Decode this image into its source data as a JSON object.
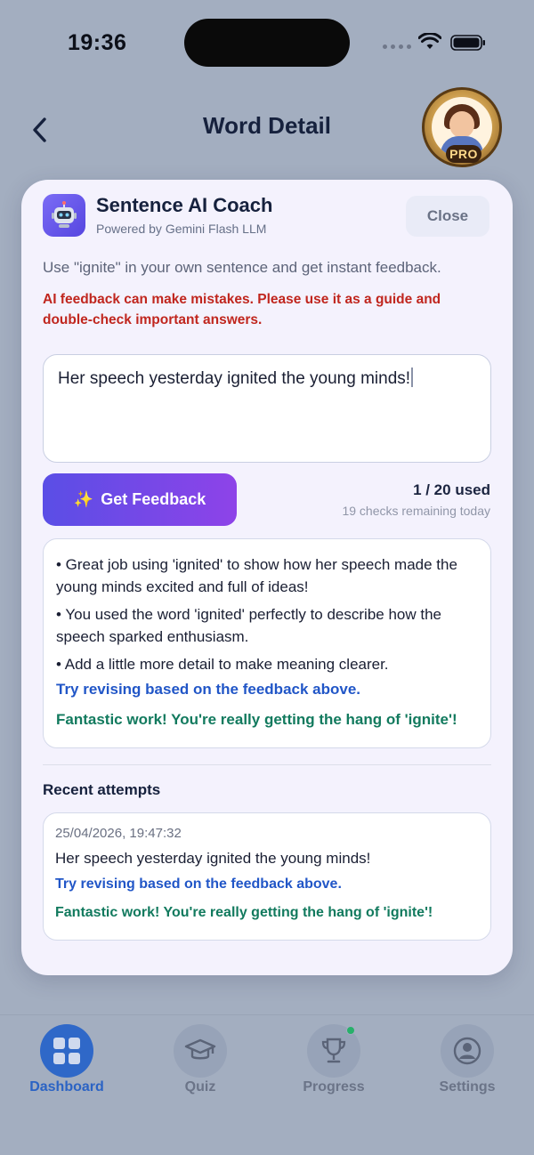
{
  "status_bar": {
    "time": "19:36"
  },
  "header": {
    "title": "Word Detail",
    "avatar_badge": "PRO"
  },
  "coach": {
    "title": "Sentence AI Coach",
    "subtitle": "Powered by Gemini Flash LLM",
    "close_label": "Close",
    "instruction": "Use \"ignite\" in your own sentence and get instant feedback.",
    "disclaimer": "AI feedback can make mistakes. Please use it as a guide and double-check important answers.",
    "input_value": "Her speech yesterday ignited the young minds!",
    "feedback_button_label": "Get Feedback",
    "usage": "1 / 20 used",
    "remaining": "19 checks remaining today",
    "feedback": {
      "points": [
        "• Great job using 'ignited' to show how her speech made the young minds excited and full of ideas!",
        "• You used the word 'ignited' perfectly to describe how the speech sparked enthusiasm.",
        "• Add a little more detail to make meaning clearer."
      ],
      "revise": "Try revising based on the feedback above.",
      "praise": "Fantastic work! You're really getting the hang of 'ignite'!"
    },
    "recent_title": "Recent attempts",
    "attempts": [
      {
        "timestamp": "25/04/2026, 19:47:32",
        "sentence": "Her speech yesterday ignited the young minds!",
        "revise": "Try revising based on the feedback above.",
        "praise": "Fantastic work! You're really getting the hang of 'ignite'!"
      }
    ]
  },
  "nav": {
    "items": [
      {
        "label": "Dashboard",
        "icon": "grid-icon",
        "active": true
      },
      {
        "label": "Quiz",
        "icon": "graduation-cap-icon",
        "active": false
      },
      {
        "label": "Progress",
        "icon": "trophy-icon",
        "active": false
      },
      {
        "label": "Settings",
        "icon": "user-circle-icon",
        "active": false
      }
    ]
  },
  "colors": {
    "accent": "#5a4ee6",
    "disclaimer": "#c0261e",
    "revise": "#2156c7",
    "praise": "#127a5e",
    "nav_active": "#2f68c8"
  }
}
